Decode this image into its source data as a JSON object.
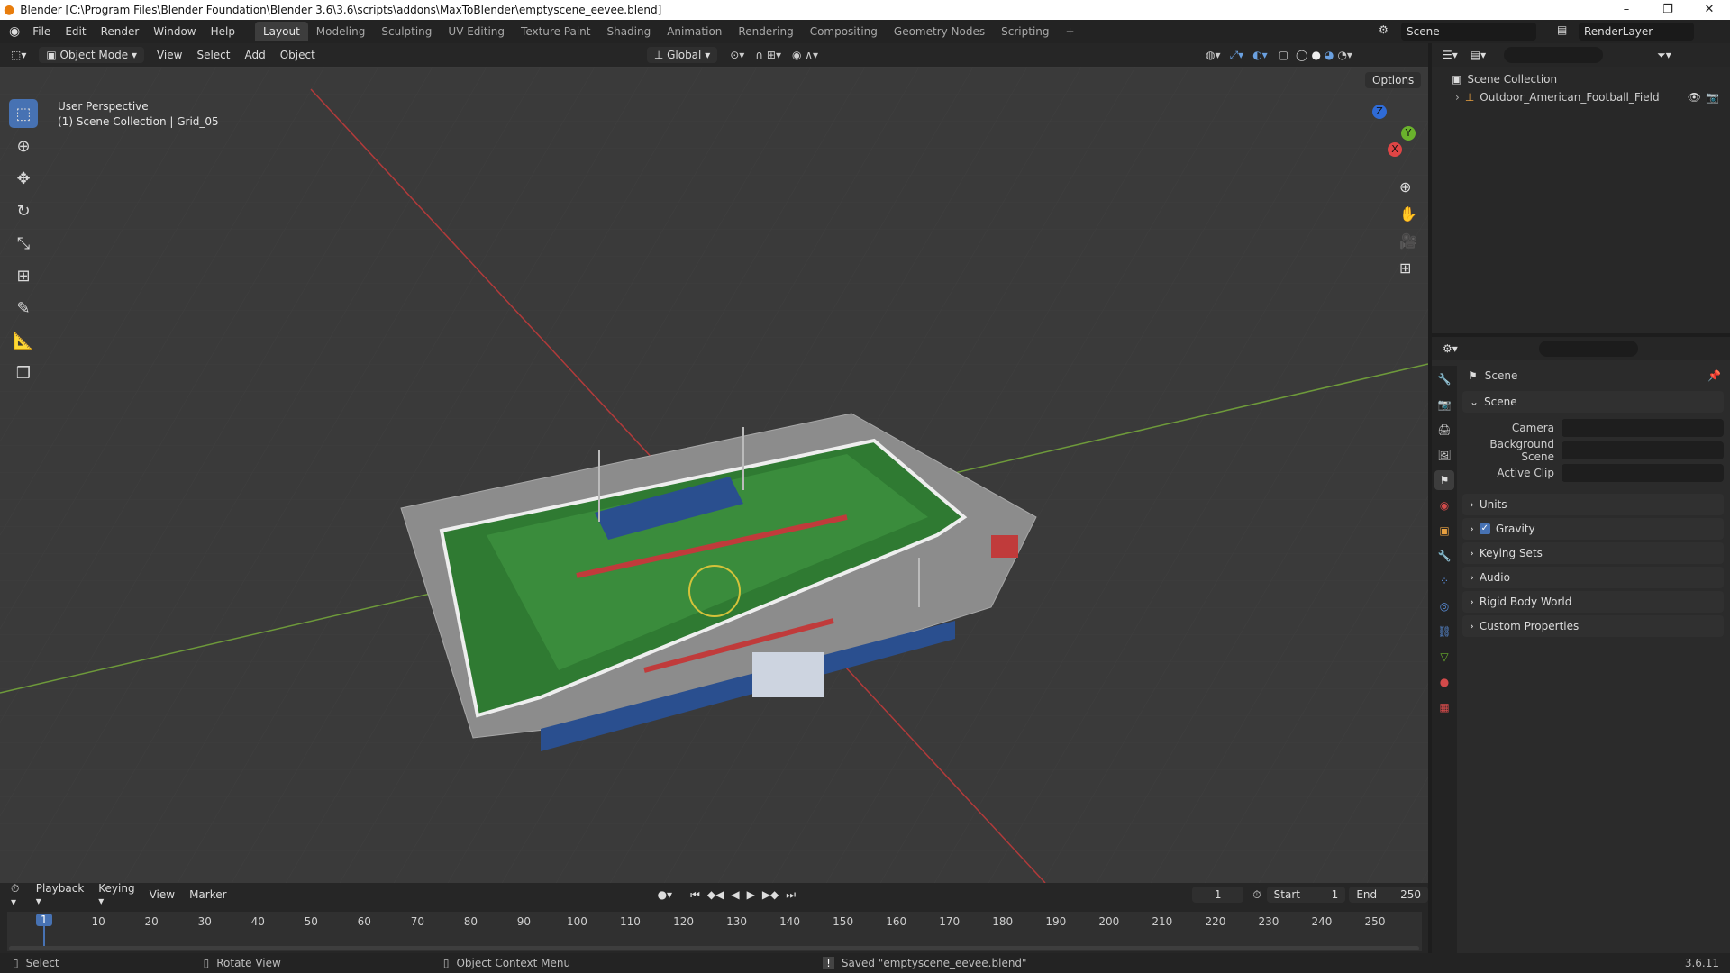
{
  "window": {
    "title": "Blender [C:\\Program Files\\Blender Foundation\\Blender 3.6\\3.6\\scripts\\addons\\MaxToBlender\\emptyscene_eevee.blend]"
  },
  "menu": {
    "items": [
      "File",
      "Edit",
      "Render",
      "Window",
      "Help"
    ]
  },
  "workspaces": {
    "tabs": [
      "Layout",
      "Modeling",
      "Sculpting",
      "UV Editing",
      "Texture Paint",
      "Shading",
      "Animation",
      "Rendering",
      "Compositing",
      "Geometry Nodes",
      "Scripting"
    ],
    "active": "Layout"
  },
  "scene": {
    "name": "Scene",
    "view_layer": "RenderLayer"
  },
  "viewport_header": {
    "mode": "Object Mode",
    "menus": [
      "View",
      "Select",
      "Add",
      "Object"
    ],
    "orientation": "Global",
    "options": "Options"
  },
  "viewport": {
    "perspective": "User Perspective",
    "collection": "(1) Scene Collection | Grid_05"
  },
  "gizmo": {
    "x": "X",
    "y": "Y",
    "z": "Z"
  },
  "outliner": {
    "root": "Scene Collection",
    "items": [
      "Outdoor_American_Football_Field"
    ]
  },
  "properties": {
    "header": "Scene",
    "panel": "Scene",
    "fields": [
      {
        "label": "Camera"
      },
      {
        "label": "Background Scene"
      },
      {
        "label": "Active Clip"
      }
    ],
    "sections": [
      "Units",
      "Gravity",
      "Keying Sets",
      "Audio",
      "Rigid Body World",
      "Custom Properties"
    ]
  },
  "timeline": {
    "menus": [
      "Playback",
      "Keying",
      "View",
      "Marker"
    ],
    "current_frame": "1",
    "start_label": "Start",
    "start": "1",
    "end_label": "End",
    "end": "250",
    "ticks": [
      "1",
      "10",
      "20",
      "30",
      "40",
      "50",
      "60",
      "70",
      "80",
      "90",
      "100",
      "110",
      "120",
      "130",
      "140",
      "150",
      "160",
      "170",
      "180",
      "190",
      "200",
      "210",
      "220",
      "230",
      "240",
      "250"
    ]
  },
  "statusbar": {
    "select": "Select",
    "rotate": "Rotate View",
    "context": "Object Context Menu",
    "message": "Saved \"emptyscene_eevee.blend\"",
    "version": "3.6.11"
  },
  "colors": {
    "accent": "#4772b3",
    "field_green": "#2f7a32",
    "track_red": "#c03b3b"
  }
}
